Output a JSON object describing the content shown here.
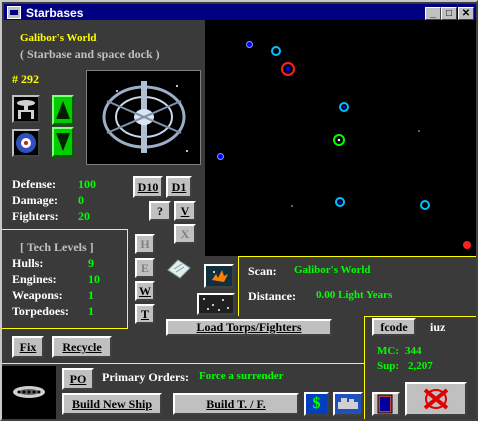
{
  "window": {
    "title": "Starbases"
  },
  "base": {
    "planet_name": "Galibor's World",
    "description": "( Starbase and space dock )",
    "id_label": "# 292"
  },
  "stats": {
    "defense_label": "Defense:",
    "defense": "100",
    "damage_label": "Damage:",
    "damage": "0",
    "fighters_label": "Fighters:",
    "fighters": "20"
  },
  "tech": {
    "header": "[ Tech Levels ]",
    "hulls_label": "Hulls:",
    "hulls": "9",
    "engines_label": "Engines:",
    "engines": "10",
    "weapons_label": "Weapons:",
    "weapons": "1",
    "torpedoes_label": "Torpedoes:",
    "torpedoes": "1"
  },
  "buttons": {
    "d10": "D10",
    "d1": "D1",
    "q": "?",
    "v": "V",
    "x": "X",
    "h": "H",
    "e": "E",
    "w": "W",
    "t": "T",
    "fix": "Fix",
    "recycle": "Recycle",
    "po": "PO",
    "build_ship": "Build New Ship",
    "build_tf": "Build T. / F.",
    "load": "Load Torps/Fighters",
    "fcode": "fcode",
    "dollar": "$"
  },
  "scan": {
    "scan_label": "Scan:",
    "scan_value": "Galibor's World",
    "distance_label": "Distance:",
    "distance_value": "0.00 Light Years"
  },
  "orders": {
    "label": "Primary Orders:",
    "value": "Force a surrender"
  },
  "fcode_value": "iuz",
  "resources": {
    "mc_label": "MC:",
    "mc": "344",
    "sup_label": "Sup:",
    "sup": "2,207"
  },
  "colors": {
    "accent_yellow": "#ffff00",
    "value_green": "#00ff00",
    "titlebar": "#000080",
    "panel": "#3a3a3a"
  }
}
